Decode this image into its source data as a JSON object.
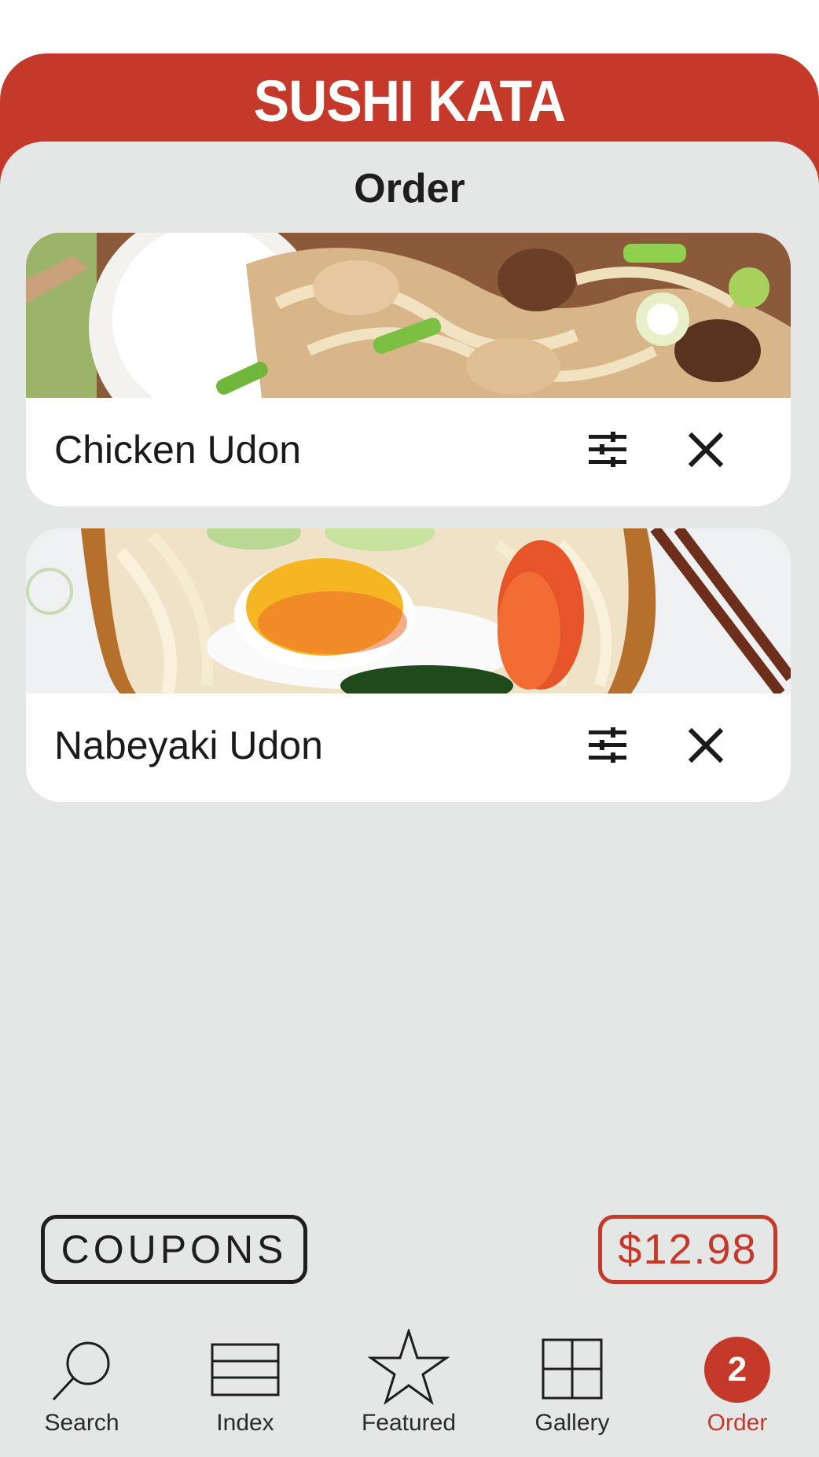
{
  "header": {
    "brand": "SUSHI KATA",
    "page_title": "Order"
  },
  "order_items": [
    {
      "name": "Chicken Udon",
      "customize_icon": "sliders-icon",
      "remove_icon": "close-icon"
    },
    {
      "name": "Nabeyaki Udon",
      "customize_icon": "sliders-icon",
      "remove_icon": "close-icon"
    }
  ],
  "footer": {
    "coupons_label": "COUPONS",
    "total": "$12.98"
  },
  "tabs": [
    {
      "label": "Search",
      "icon": "search-icon"
    },
    {
      "label": "Index",
      "icon": "list-icon"
    },
    {
      "label": "Featured",
      "icon": "star-icon"
    },
    {
      "label": "Gallery",
      "icon": "grid-icon"
    },
    {
      "label": "Order",
      "icon": "order-badge",
      "badge": "2",
      "active": true
    }
  ],
  "colors": {
    "brand_red": "#c4392a",
    "panel_gray": "#e5e6e6",
    "text_dark": "#1e1e1e"
  }
}
